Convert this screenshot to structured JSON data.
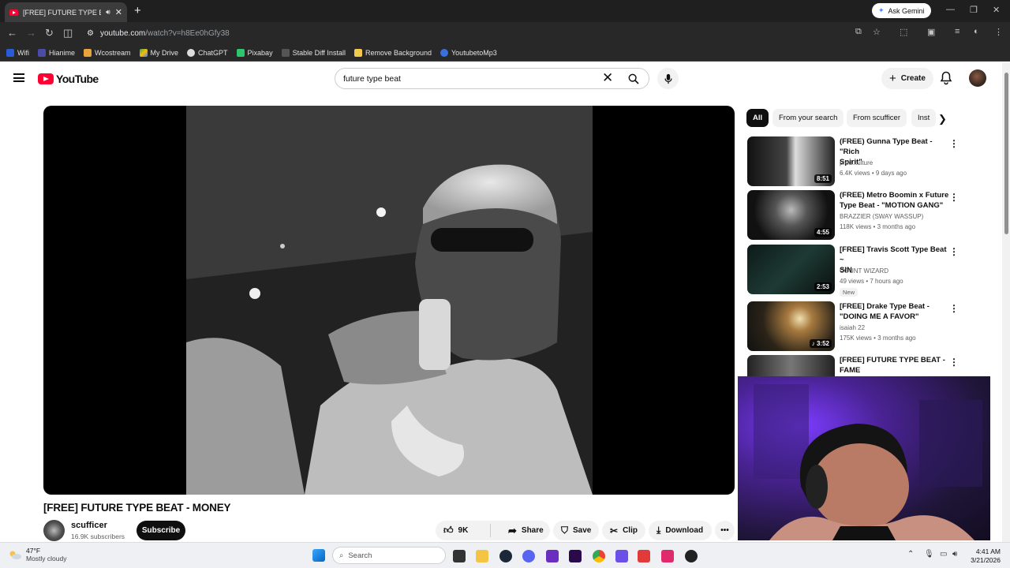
{
  "browser": {
    "tab_title": "[FREE] FUTURE TYPE BEAT -",
    "new_tab": "+",
    "ask_gemini": "Ask Gemini",
    "url_host": "youtube.com",
    "url_path": "/watch?v=h8Ee0hGfy38",
    "bookmarks": [
      "Wifi",
      "Hianime",
      "Wcostream",
      "My Drive",
      "ChatGPT",
      "Pixabay",
      "Stable Diff Install",
      "Remove Background",
      "YoutubetoMp3"
    ]
  },
  "youtube": {
    "logo_text": "YouTube",
    "search_value": "future type beat",
    "create_label": "Create"
  },
  "video": {
    "title": "[FREE] FUTURE TYPE BEAT - MONEY",
    "channel": "scufficer",
    "subscribers": "16.9K subscribers",
    "subscribe_label": "Subscribe",
    "likes": "9K",
    "share_label": "Share",
    "save_label": "Save",
    "clip_label": "Clip",
    "download_label": "Download"
  },
  "chips": [
    "All",
    "From your search",
    "From scufficer",
    "Inst"
  ],
  "recommendations": [
    {
      "title_line1": "(FREE) Gunna Type Beat - \"Rich",
      "title_line2": "Spirit\"",
      "channel": "prod.kulture",
      "meta": "6.4K views • 9 days ago",
      "duration": "8:51"
    },
    {
      "title_line1": "(FREE) Metro Boomin x Future",
      "title_line2": "Type Beat - \"MOTION GANG\"",
      "channel": "BRAZZIER (SWAY WASSUP)",
      "meta": "118K views • 3 months ago",
      "duration": "4:55"
    },
    {
      "title_line1": "[FREE] Travis Scott Type Beat ~",
      "title_line2": "SIN",
      "channel": "COUNT WIZARD",
      "meta": "49 views • 7 hours ago",
      "duration": "2:53",
      "badge": "New"
    },
    {
      "title_line1": "[FREE] Drake Type Beat -",
      "title_line2": "\"DOING ME A FAVOR\"",
      "channel": "isaiah 22",
      "meta": "175K views • 3 months ago",
      "duration": "3:52"
    },
    {
      "title_line1": "[FREE] FUTURE TYPE BEAT -",
      "title_line2": "FAME",
      "channel": "",
      "meta": "",
      "duration": ""
    }
  ],
  "taskbar": {
    "temperature": "47°F",
    "condition": "Mostly cloudy",
    "search_placeholder": "Search",
    "time": "4:41 AM",
    "date": "3/21/2026"
  },
  "colors": {
    "youtube_red": "#ff0033",
    "chrome_dark": "#1f1f1f",
    "webcam_purple": "#7b3cff"
  }
}
